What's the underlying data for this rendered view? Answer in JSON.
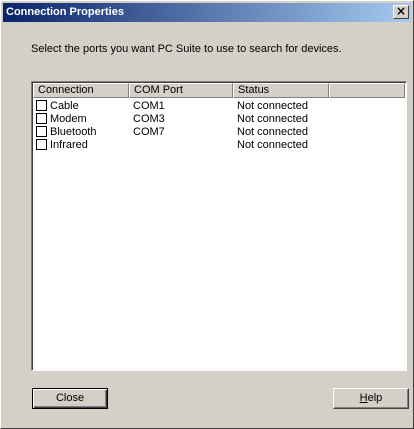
{
  "window": {
    "title": "Connection Properties",
    "close_glyph": "×"
  },
  "instruction": "Select the ports you want PC Suite to use to search for devices.",
  "table": {
    "columns": [
      "Connection",
      "COM Port",
      "Status",
      ""
    ],
    "rows": [
      {
        "connection": "Cable",
        "com_port": "COM1",
        "status": "Not connected",
        "checked": false
      },
      {
        "connection": "Modem",
        "com_port": "COM3",
        "status": "Not connected",
        "checked": false
      },
      {
        "connection": "Bluetooth",
        "com_port": "COM7",
        "status": "Not connected",
        "checked": false
      },
      {
        "connection": "Infrared",
        "com_port": "",
        "status": "Not connected",
        "checked": false
      }
    ]
  },
  "buttons": {
    "close_label": "Close",
    "help_label_prefix": "H",
    "help_label_rest": "elp"
  },
  "colors": {
    "titlebar_start": "#0a246a",
    "titlebar_end": "#a6caf0",
    "dialog_bg": "#d4d0c8"
  }
}
